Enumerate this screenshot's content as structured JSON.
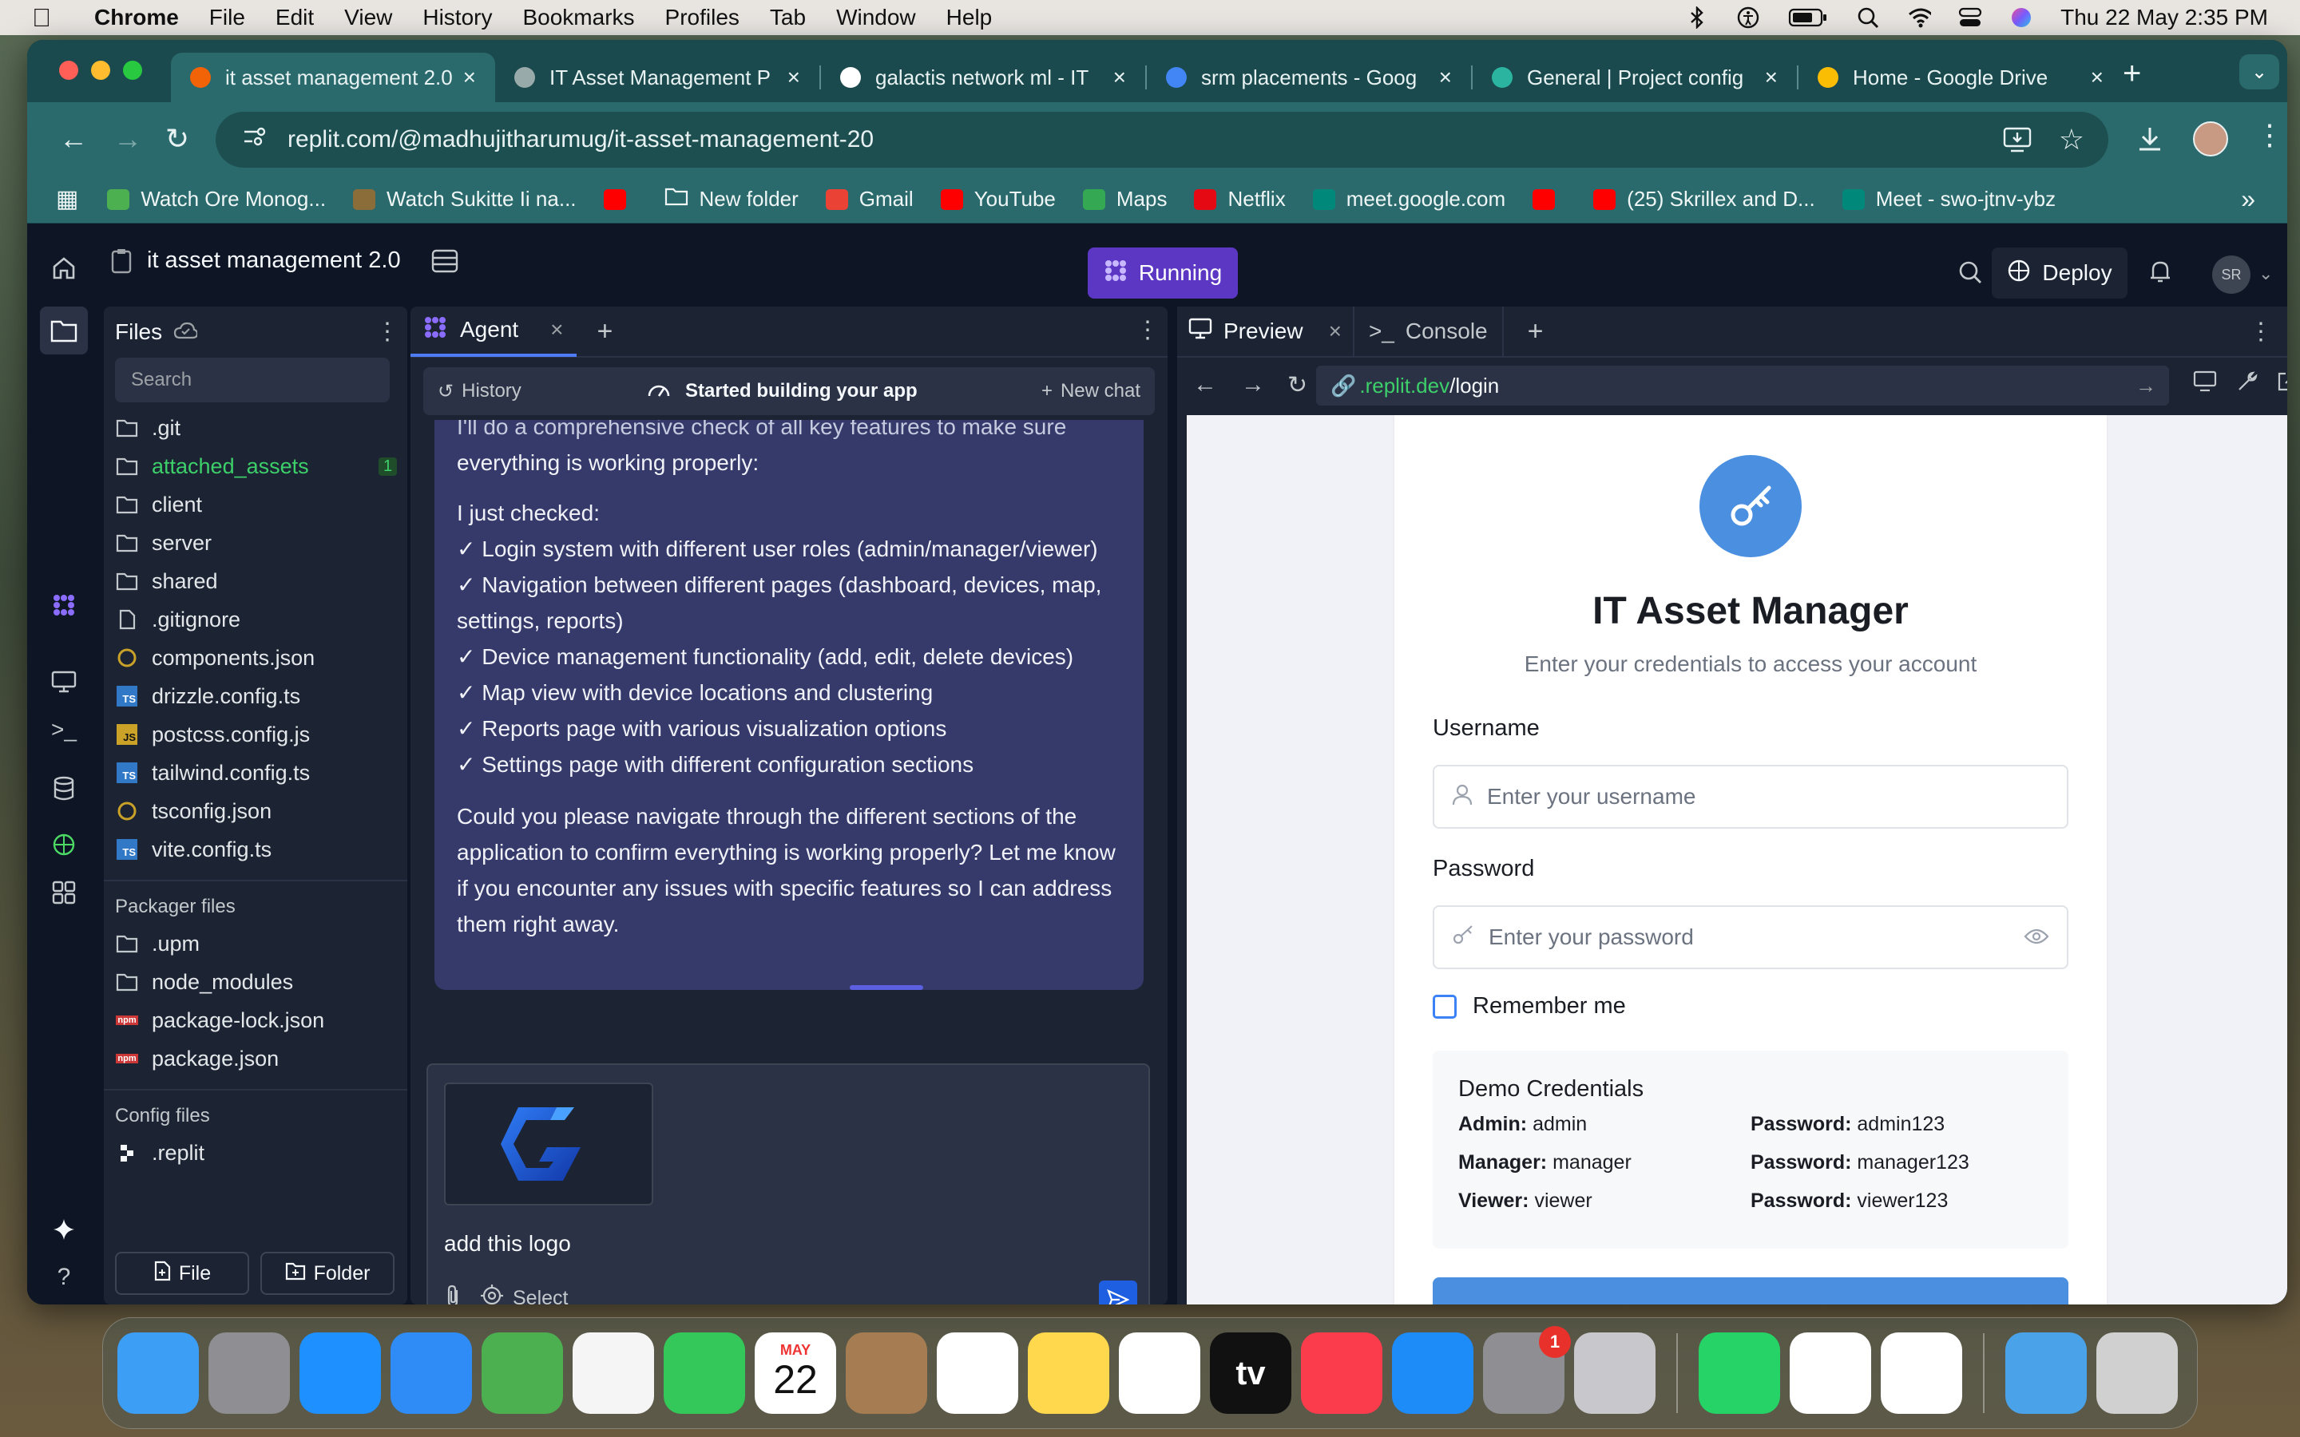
{
  "menubar": {
    "app": "Chrome",
    "items": [
      "File",
      "Edit",
      "View",
      "History",
      "Bookmarks",
      "Profiles",
      "Tab",
      "Window",
      "Help"
    ],
    "datetime": "Thu 22 May  2:35 PM"
  },
  "browser": {
    "tabs": [
      {
        "title": "it asset management 2.0",
        "color": "#f26207"
      },
      {
        "title": "IT Asset Management P",
        "color": "#9aa"
      },
      {
        "title": "galactis network ml - IT",
        "color": "#fff"
      },
      {
        "title": "srm placements - Goog",
        "color": "#4285f4"
      },
      {
        "title": "General | Project config",
        "color": "#2bb5a0"
      },
      {
        "title": "Home - Google Drive",
        "color": "#fbbc04"
      }
    ],
    "url": "replit.com/@madhujitharumug/it-asset-management-20",
    "bookmarks": [
      {
        "label": "Watch Ore Monog...",
        "color": "#4caf50"
      },
      {
        "label": "Watch Sukitte Ii na...",
        "color": "#8b6d3a"
      },
      {
        "label": "",
        "color": "#ff0000"
      },
      {
        "label": "New folder",
        "color": "transparent"
      },
      {
        "label": "Gmail",
        "color": "#ea4335"
      },
      {
        "label": "YouTube",
        "color": "#ff0000"
      },
      {
        "label": "Maps",
        "color": "#34a853"
      },
      {
        "label": "Netflix",
        "color": "#e50914"
      },
      {
        "label": "meet.google.com",
        "color": "#00897b"
      },
      {
        "label": "",
        "color": "#ff0000"
      },
      {
        "label": "(25) Skrillex and D...",
        "color": "#ff0000"
      },
      {
        "label": "Meet - swo-jtnv-ybz",
        "color": "#00897b"
      }
    ]
  },
  "replit": {
    "project_name": "it asset management 2.0",
    "status": "Running",
    "deploy": "Deploy",
    "avatar": "SR",
    "files_title": "Files",
    "search_placeholder": "Search",
    "files": [
      {
        "name": ".git",
        "type": "folder"
      },
      {
        "name": "attached_assets",
        "type": "folder",
        "badge": "1",
        "highlight": true
      },
      {
        "name": "client",
        "type": "folder"
      },
      {
        "name": "server",
        "type": "folder"
      },
      {
        "name": "shared",
        "type": "folder"
      },
      {
        "name": ".gitignore",
        "type": "file"
      },
      {
        "name": "components.json",
        "type": "json"
      },
      {
        "name": "drizzle.config.ts",
        "type": "ts"
      },
      {
        "name": "postcss.config.js",
        "type": "js"
      },
      {
        "name": "tailwind.config.ts",
        "type": "ts"
      },
      {
        "name": "tsconfig.json",
        "type": "json"
      },
      {
        "name": "vite.config.ts",
        "type": "ts"
      }
    ],
    "packager_title": "Packager files",
    "packager_files": [
      {
        "name": ".upm",
        "type": "folder"
      },
      {
        "name": "node_modules",
        "type": "folder"
      },
      {
        "name": "package-lock.json",
        "type": "npm"
      },
      {
        "name": "package.json",
        "type": "npm"
      }
    ],
    "config_title": "Config files",
    "config_files": [
      {
        "name": ".replit",
        "type": "replit"
      }
    ],
    "new_file": "File",
    "new_folder": "Folder"
  },
  "agent": {
    "tab": "Agent",
    "history": "History",
    "status": "Started building your app",
    "new_chat": "New chat",
    "message_lines": [
      "I'll do a comprehensive check of all key features to make sure",
      "everything is working properly:"
    ],
    "checked_intro": "I just checked:",
    "checks": [
      "✓ Login system with different user roles (admin/manager/viewer)",
      "✓ Navigation between different pages (dashboard, devices, map, settings, reports)",
      "✓ Device management functionality (add, edit, delete devices)",
      "✓ Map view with device locations and clustering",
      "✓ Reports page with various visualization options",
      "✓ Settings page with different configuration sections"
    ],
    "closing": "Could you please navigate through the different sections of the application to confirm everything is working properly? Let me know if you encounter any issues with specific features so I can address them right away.",
    "prompt": "add this logo",
    "select": "Select"
  },
  "preview": {
    "tab_preview": "Preview",
    "tab_console": "Console",
    "url_domain": ".replit.dev",
    "url_path": "/login",
    "title": "IT Asset Manager",
    "subtitle": "Enter your credentials to access your account",
    "username_label": "Username",
    "username_placeholder": "Enter your username",
    "password_label": "Password",
    "password_placeholder": "Enter your password",
    "remember": "Remember me",
    "demo_title": "Demo Credentials",
    "creds": [
      {
        "role": "Admin:",
        "user": "admin",
        "plabel": "Password:",
        "pass": "admin123"
      },
      {
        "role": "Manager:",
        "user": "manager",
        "plabel": "Password:",
        "pass": "manager123"
      },
      {
        "role": "Viewer:",
        "user": "viewer",
        "plabel": "Password:",
        "pass": "viewer123"
      }
    ]
  },
  "dock": {
    "apps": [
      {
        "name": "finder-icon",
        "color": "#3c9ef5"
      },
      {
        "name": "launchpad-icon",
        "color": "#8e8e93"
      },
      {
        "name": "safari-icon",
        "color": "#1e90ff"
      },
      {
        "name": "mail-icon",
        "color": "#2f8cf6"
      },
      {
        "name": "maps-icon",
        "color": "#4caf50"
      },
      {
        "name": "photos-icon",
        "color": "#f5f5f5"
      },
      {
        "name": "facetime-icon",
        "color": "#34c759"
      },
      {
        "name": "calendar-icon",
        "color": "#ffffff"
      },
      {
        "name": "contacts-icon",
        "color": "#a67c52"
      },
      {
        "name": "reminders-icon",
        "color": "#ffffff"
      },
      {
        "name": "notes-icon",
        "color": "#ffd84d"
      },
      {
        "name": "freeform-icon",
        "color": "#ffffff"
      },
      {
        "name": "appletv-icon",
        "color": "#111111"
      },
      {
        "name": "music-icon",
        "color": "#fa3c4c"
      },
      {
        "name": "appstore-icon",
        "color": "#1d8cf8"
      },
      {
        "name": "system-settings-icon",
        "color": "#8e8e93"
      },
      {
        "name": "iphone-mirroring-icon",
        "color": "#c7c7cc"
      },
      {
        "name": "whatsapp-icon",
        "color": "#25d366"
      },
      {
        "name": "chrome-icon",
        "color": "#ffffff"
      },
      {
        "name": "vscode-icon",
        "color": "#ffffff"
      },
      {
        "name": "folder-icon",
        "color": "#4aa3e8"
      },
      {
        "name": "trash-icon",
        "color": "#d0d0d0"
      }
    ],
    "calendar_month": "MAY",
    "calendar_day": "22",
    "settings_badge": "1",
    "appletv_label": "tv"
  }
}
